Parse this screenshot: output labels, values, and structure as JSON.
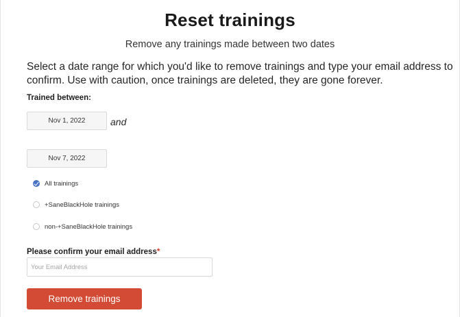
{
  "page": {
    "title": "Reset trainings",
    "subtitle": "Remove any trainings made between two dates",
    "description": "Select a date range for which you'd like to remove trainings and type your email address to confirm. Use with caution, once trainings are deleted, they are gone forever."
  },
  "date_range": {
    "label": "Trained between:",
    "from": "Nov 1, 2022",
    "joiner": "and",
    "to": "Nov 7, 2022"
  },
  "training_filter": {
    "selected": "All trainings",
    "options": [
      {
        "label": "All trainings",
        "checked": true
      },
      {
        "label": "+SaneBlackHole trainings",
        "checked": false
      },
      {
        "label": "non-+SaneBlackHole trainings",
        "checked": false
      }
    ]
  },
  "email": {
    "label": "Please confirm your email address",
    "required_marker": "*",
    "value": "",
    "placeholder": "Your Email Address"
  },
  "actions": {
    "remove_label": "Remove trainings"
  },
  "colors": {
    "accent_button": "#d34b35",
    "radio_checked": "#4a72c4",
    "required": "#d23b2f"
  }
}
